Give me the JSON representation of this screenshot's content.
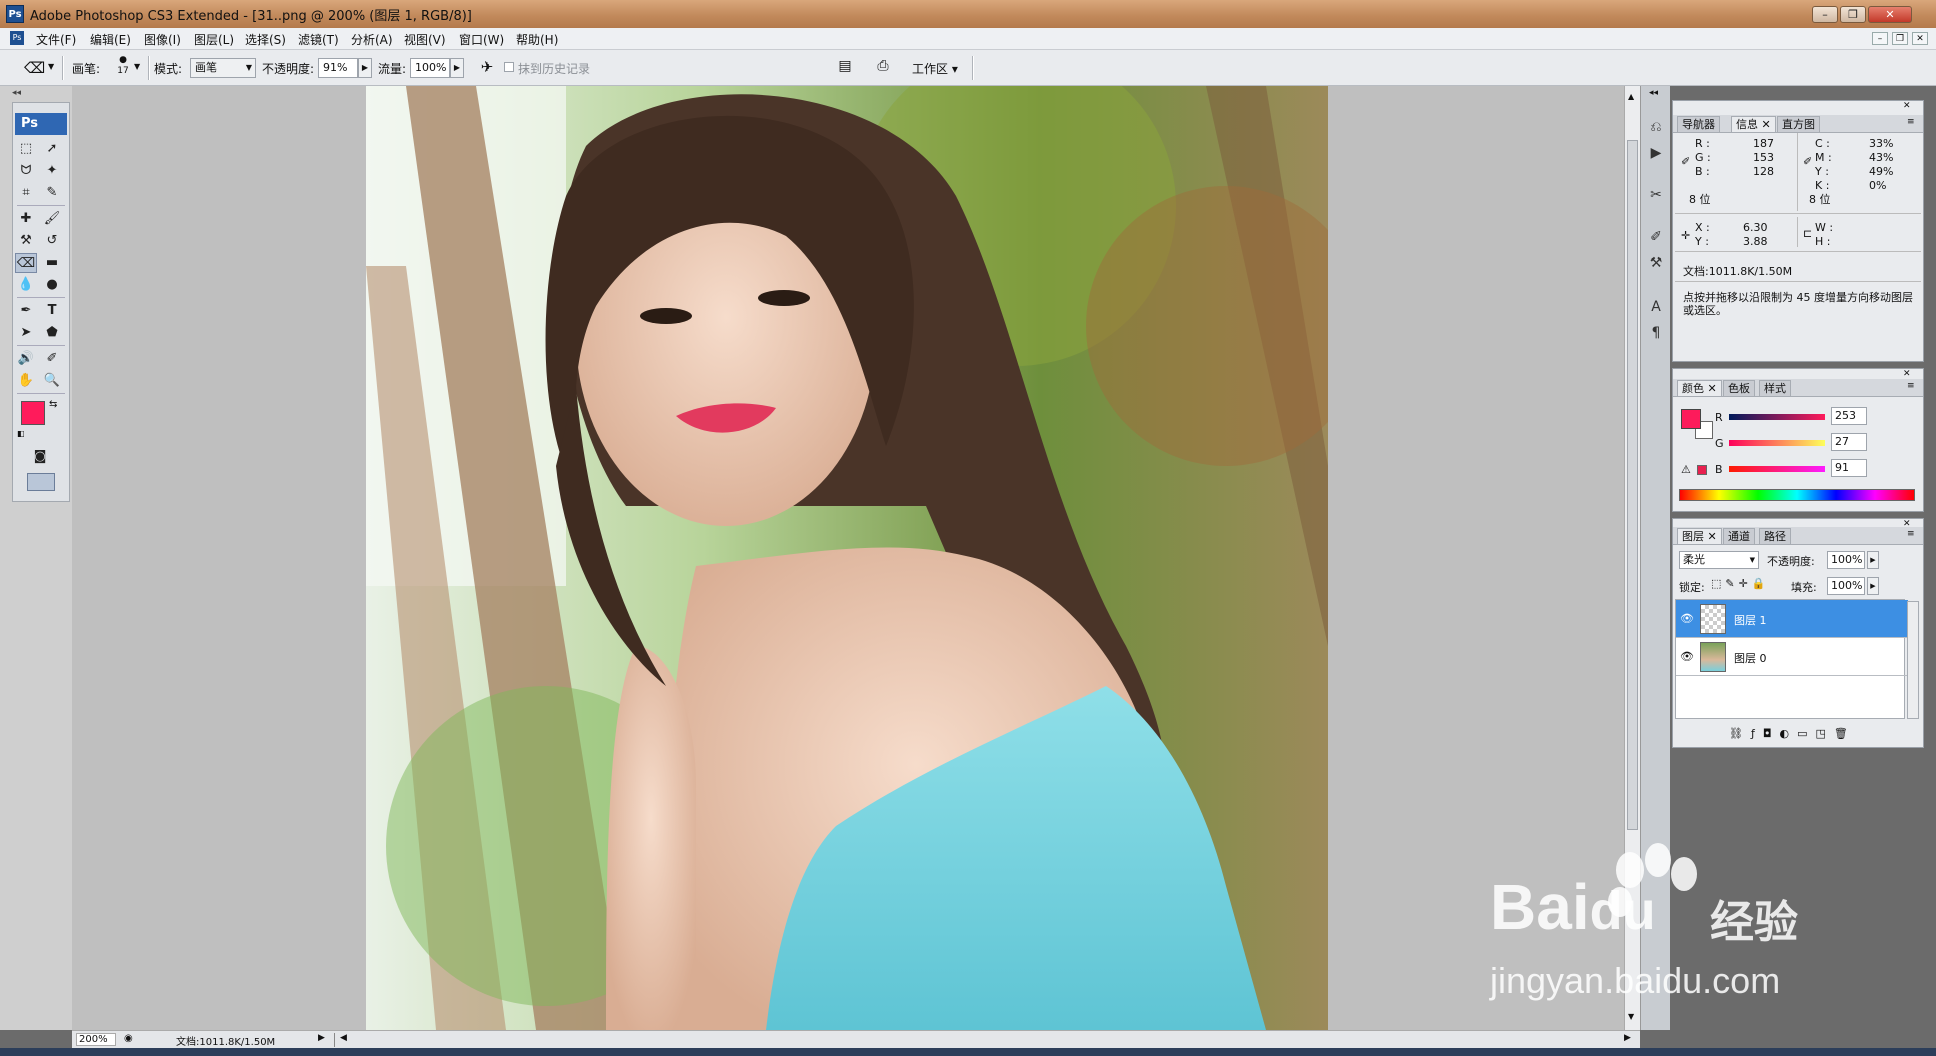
{
  "titlebar": {
    "title": "Adobe Photoshop CS3 Extended - [31..png @ 200% (图层 1, RGB/8)]",
    "app_icon": "Ps",
    "minimize": "–",
    "restore": "❐",
    "close": "✕"
  },
  "menubar": {
    "items": [
      "文件(F)",
      "编辑(E)",
      "图像(I)",
      "图层(L)",
      "选择(S)",
      "滤镜(T)",
      "分析(A)",
      "视图(V)",
      "窗口(W)",
      "帮助(H)"
    ]
  },
  "options": {
    "brush_label": "画笔:",
    "brush_size": "17",
    "mode_label": "模式:",
    "mode_value": "画笔",
    "opacity_label": "不透明度:",
    "opacity_value": "91%",
    "flow_label": "流量:",
    "flow_value": "100%",
    "history_label": "抹到历史记录",
    "workspace_label": "工作区 ▾"
  },
  "toolbox": {
    "logo": "Ps",
    "foreground_color": "#ff1b5b",
    "background_color": "#ffffff"
  },
  "statusbar": {
    "zoom": "200%",
    "doc": "文档:1011.8K/1.50M"
  },
  "info_panel": {
    "tabs": [
      "导航器",
      "信息",
      "直方图"
    ],
    "r_label": "R :",
    "r": "187",
    "g_label": "G :",
    "g": "153",
    "b_label": "B :",
    "b": "128",
    "bit_left": "8 位",
    "c_label": "C :",
    "c": "33%",
    "m_label": "M :",
    "m": "43%",
    "y_label": "Y :",
    "y": "49%",
    "k_label": "K :",
    "k": "0%",
    "bit_right": "8 位",
    "x_label": "X :",
    "x": "6.30",
    "y2_label": "Y :",
    "y2": "3.88",
    "w_label": "W :",
    "h_label": "H :",
    "doc": "文档:1011.8K/1.50M",
    "hint": "点按并拖移以沿限制为 45 度增量方向移动图层或选区。"
  },
  "color_panel": {
    "tabs": [
      "颜色",
      "色板",
      "样式"
    ],
    "r_label": "R",
    "r": "253",
    "g_label": "G",
    "g": "27",
    "b_label": "B",
    "b": "91",
    "swatch": "#fd1b5b"
  },
  "layers_panel": {
    "tabs": [
      "图层",
      "通道",
      "路径"
    ],
    "blend_mode": "柔光",
    "opacity_label": "不透明度:",
    "opacity": "100%",
    "lock_label": "锁定:",
    "fill_label": "填充:",
    "fill": "100%",
    "layers": [
      {
        "name": "图层 1",
        "selected": true
      },
      {
        "name": "图层 0",
        "selected": false
      }
    ]
  },
  "watermark": {
    "brand": "Bai",
    "brand2": "du",
    "brand_cn": "经验",
    "url": "jingyan.baidu.com"
  }
}
